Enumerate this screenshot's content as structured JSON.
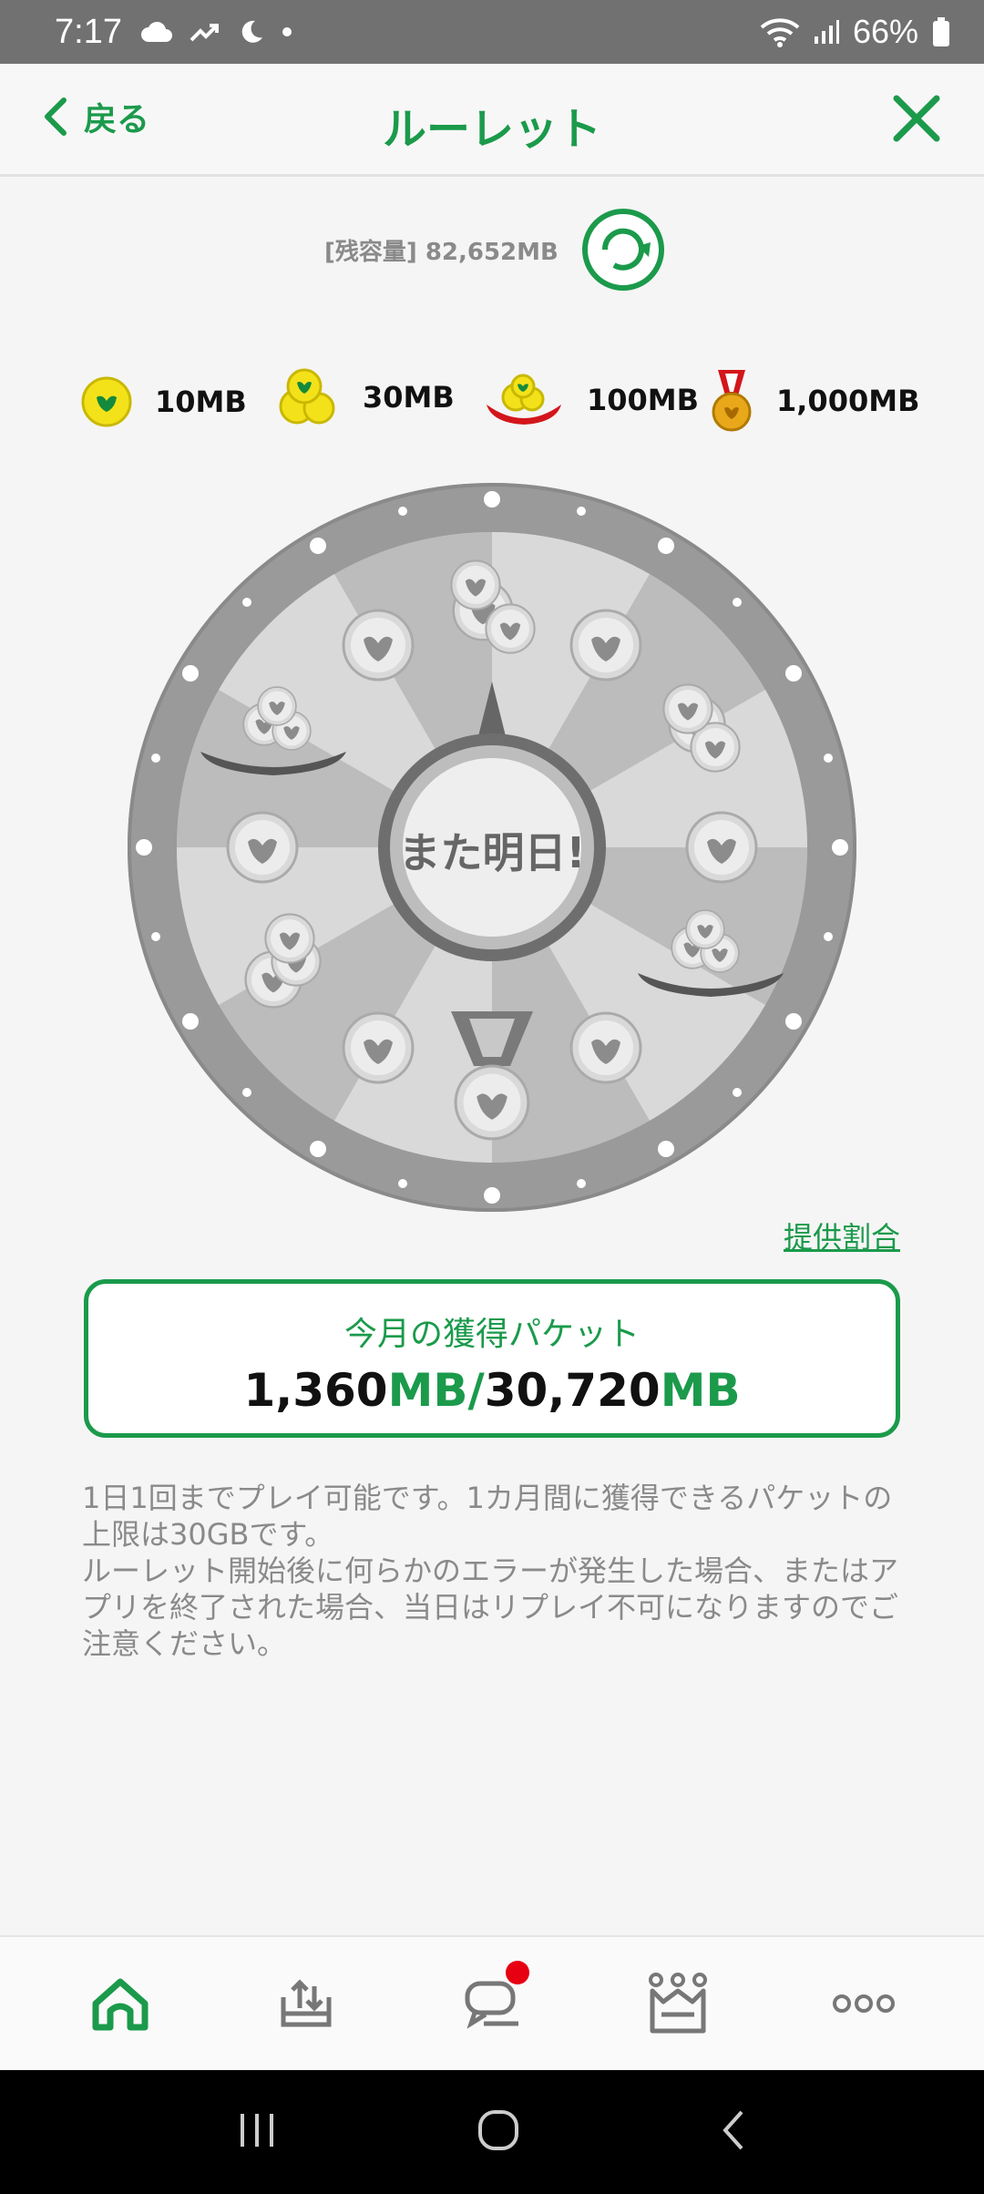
{
  "status_bar": {
    "time": "7:17",
    "battery": "66%"
  },
  "header": {
    "back_label": "戻る",
    "title": "ルーレット"
  },
  "remaining": {
    "text": "[残容量] 82,652MB"
  },
  "legend": [
    {
      "label": "10MB",
      "icon": "single-coin-icon"
    },
    {
      "label": "30MB",
      "icon": "coin-stack-icon"
    },
    {
      "label": "100MB",
      "icon": "coin-tray-icon"
    },
    {
      "label": "1,000MB",
      "icon": "gold-medal-icon"
    }
  ],
  "wheel": {
    "center_label": "また明日!"
  },
  "rate_link": "提供割合",
  "packet": {
    "label": "今月の獲得パケット",
    "earned": "1,360",
    "earned_unit": "MB",
    "separator": "/",
    "limit": "30,720",
    "limit_unit": "MB"
  },
  "notes": {
    "line1": "1日1回までプレイ可能です。1カ月間に獲得できるパケットの上限は30GBです。",
    "line2": "ルーレット開始後に何らかのエラーが発生した場合、またはアプリを終了された場合、当日はリプレイ不可になりますのでご注意ください。"
  },
  "bottom_nav": [
    {
      "name": "home",
      "icon": "home-icon"
    },
    {
      "name": "data-gift",
      "icon": "data-transfer-icon"
    },
    {
      "name": "chat",
      "icon": "chat-icon"
    },
    {
      "name": "rank",
      "icon": "crown-icon"
    },
    {
      "name": "more",
      "icon": "more-icon"
    }
  ],
  "colors": {
    "accent": "#1b9a4b",
    "badge": "#e60012"
  }
}
